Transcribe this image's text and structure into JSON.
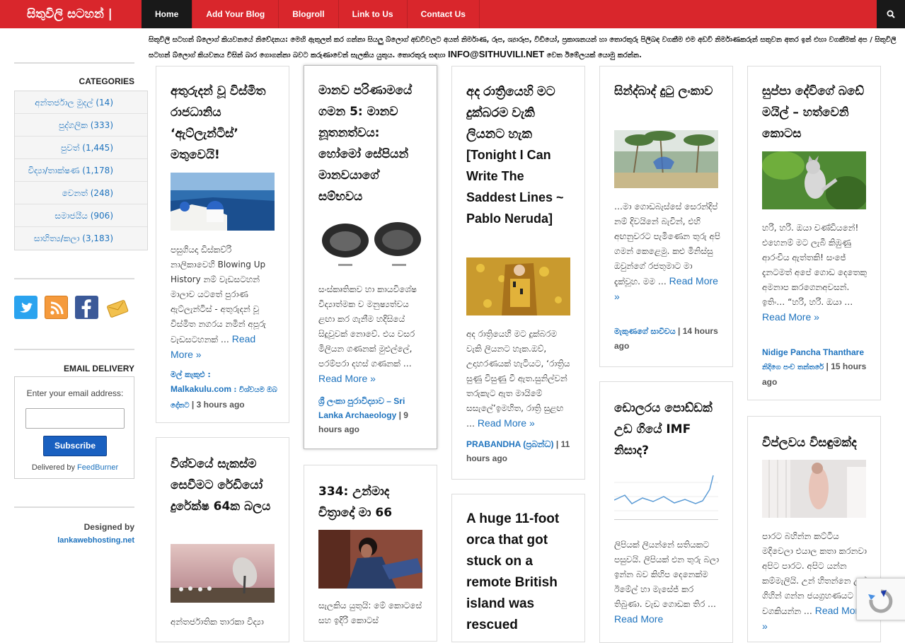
{
  "header": {
    "logo": "සිතුවිලි සටහන් |",
    "nav": [
      "Home",
      "Add Your Blog",
      "Blogroll",
      "Link to Us",
      "Contact Us"
    ]
  },
  "notice": {
    "text": "සිතුවිලි සටහන් බ්ලොග් කියවනයේ නිවේදනය: මෙහි ඇතුලත් කර ගන්නා සියලු බ්ලොග් අඩවිවලට අයත් නිර්මාණ, රූප, ශ්‍යාරූප, විඩියෝ, ප්‍රකාශනයන් හා තොරතුරු පිලිබඳ වගකීම එම අඩවි නිර්මාණකරුන් සතුවන අතර ඉන් එහා වගකීමක් අප / සිතුවිලි සටහන් බ්ලොග් කියවනය විසින් බාර ගොගන්නා බවට කරුණාවෙන් සැලකිය යුතුය. තොරතුරු සඳහා",
    "email": "INFO@SITHUVILI.NET",
    "tail": "වෙත ඊමේලයක් යොමු කරන්න."
  },
  "sidebar": {
    "categories_title": "CATEGORIES",
    "categories": [
      "අන්තර්ජාල මුදල් (14)",
      "පුද්ගලික (333)",
      "පුවත් (1,445)",
      "විද්‍යා/තාක්ෂණ (1,178)",
      "වෙනත් (248)",
      "සමාජයීය (906)",
      "සාහිත්‍ය/කලා (3,183)"
    ],
    "email_title": "EMAIL DELIVERY",
    "email_label": "Enter your email address:",
    "subscribe": "Subscribe",
    "delivered_by": "Delivered by",
    "feedburner": "FeedBurner",
    "designed_by": "Designed by",
    "designer": "lankawebhosting.net",
    "social_icons": [
      "twitter-icon",
      "rss-icon",
      "facebook-icon",
      "email-icon"
    ]
  },
  "posts": [
    {
      "title": "අතුරුදන් වූ විස්මිත රාජධානිය ‘ඇට්ලැන්ටිස්’ මතුවෙයි!",
      "excerpt": "පසුගියදා ඩිස්කව්රි නාලිකාවෙහි Blowing Up History නම් වැඩසටහන් මාලාව යටතේ පුරාණ ඇට්ලැන්ටිස් - අතුරුදන් වූ විස්මිත නගරය නමින් අපූරු වැඩසටහනක් …",
      "read_more": "Read More »",
      "source_prefix": "මල් කැකුළු :",
      "source": "Malkakulu.com",
      "source_suffix": ": විශ්වයම ඔබ දෝතට",
      "time": "3 hours ago"
    },
    {
      "title": "මානව පරිණාමයේ ගමන 5: මානව නූතනත්වය: හෝමෝ සේපියන් මානවයාගේ සම්භවය",
      "excerpt": "සංස්කෘතිකව හා කායවිශේෂ විද්‍යාත්මක ව මනුෂ්‍යත්වය ළඟා කර ගැනීම හදිසියේ සිදුවූවක් නොවේ. එය වසර මිලියන ගණනක් මුළුල්ලේ, පරම්පරා දහස් ගණනක් …",
      "read_more": "Read More »",
      "source": "ශ්‍රී ලංකා පුරාවිද්‍යාව – Sri Lanka Archaeology",
      "time": "9 hours ago"
    },
    {
      "title": "අද රාත්‍රියෙහි මට දුක්බරම වැකි ලියනට හැක [Tonight I Can Write The Saddest Lines ~ Pablo Neruda]",
      "excerpt": "අද රාත්‍රියෙහි මට දුක්බරම වැකි ලියනට හැක.ඔව්, උදාහරණයක් හැටියට, ‘රාත්‍රිය සුණු විසුණු වී ඇත.සුනිල්වන් තරුකැට ඇත මායිමේ සසැලේ’ඉමහිත, රාත්‍රි සුළඟ …",
      "read_more": "Read More »",
      "source": "PRABANDHA (ප්‍රබන්ධ)",
      "time": "11 hours ago"
    },
    {
      "title": "සින්ද්බාද් දුටු ලංකාව",
      "excerpt": "…මා ගොඩබැස්සේ සෙරන්දිප් නම් දිවයිනේ බැවින්, එහි අඟනුවරට පැමිණෙන තුරු අපි ගමන් කෙළෙමු. කළු මිනිස්සු ඔවුන්ගේ රජතුමාට මා දැක්වූහ. මම …",
      "read_more": "Read More »",
      "source": "මැකුණගේ සාවිචය",
      "time": "14 hours ago"
    },
    {
      "title": "සුප්පා දේවිගේ බඩේ මයිල් – හත්වෙනි කොටස",
      "excerpt": "හරි, හරි. ඔයා චණ්ඩියනේ! එහෙනම් මට ලැබී කිඹුණු ආරංචිය ඇත්තකි! සංජේ දැනටමත් අපේ ගොඩ දෙතෙකු අමනාප කරගෙනඅවසන්. ඉතිං… “හරි, හරි. ඔයා …",
      "read_more": "Read More »",
      "source": "Nidige Pancha Thanthare",
      "source_suffix": "නිදිගෙ පංච තන්තරේ",
      "time": "15 hours ago"
    },
    {
      "title": "විශ්වයේ සැකස්ම සෙවීමට රේඩියෝ දුරේක්ෂ 64ක බලය",
      "excerpt": "අන්තර්ජාතික තාරකා විද්‍යා"
    },
    {
      "title": "334: උන්මාද චිත්‍රාදෝ මා 66",
      "excerpt": "සැලකිය යුතුයි: මේ කොටසේ සහ ඉදිරි කොටස්"
    },
    {
      "title": "A huge 11-foot orca that got stuck on a remote British island was rescued"
    },
    {
      "title": "ඩොලරය පොඩ්ඩක් උඩ ගියේ IMF නිසාද?",
      "excerpt": "ලිපියක් ලියන්නේ සතියකට පසුවයි. ලිපියක් එන තුරු බලා ඉන්න බව කිහිප දෙනෙක්ම ඊමේල් හා මැසේජ් කර තිබුණා. වැඩ ගොඩක තිර …",
      "read_more": "Read More"
    },
    {
      "title": "විප්ලවය විසඳුමක්ද",
      "excerpt": "පාරට බහින්න කට්ටිය මදිවෙලා එයාල කතා කරනවා අපිට පාරට. අපිට යන්න කම්මැලියි. උන් හිතන්නෙ උන් ගිහින් ගන්න ජයග්‍රහණයට අපි වගකියන්න …",
      "read_more": "Read More »"
    }
  ]
}
